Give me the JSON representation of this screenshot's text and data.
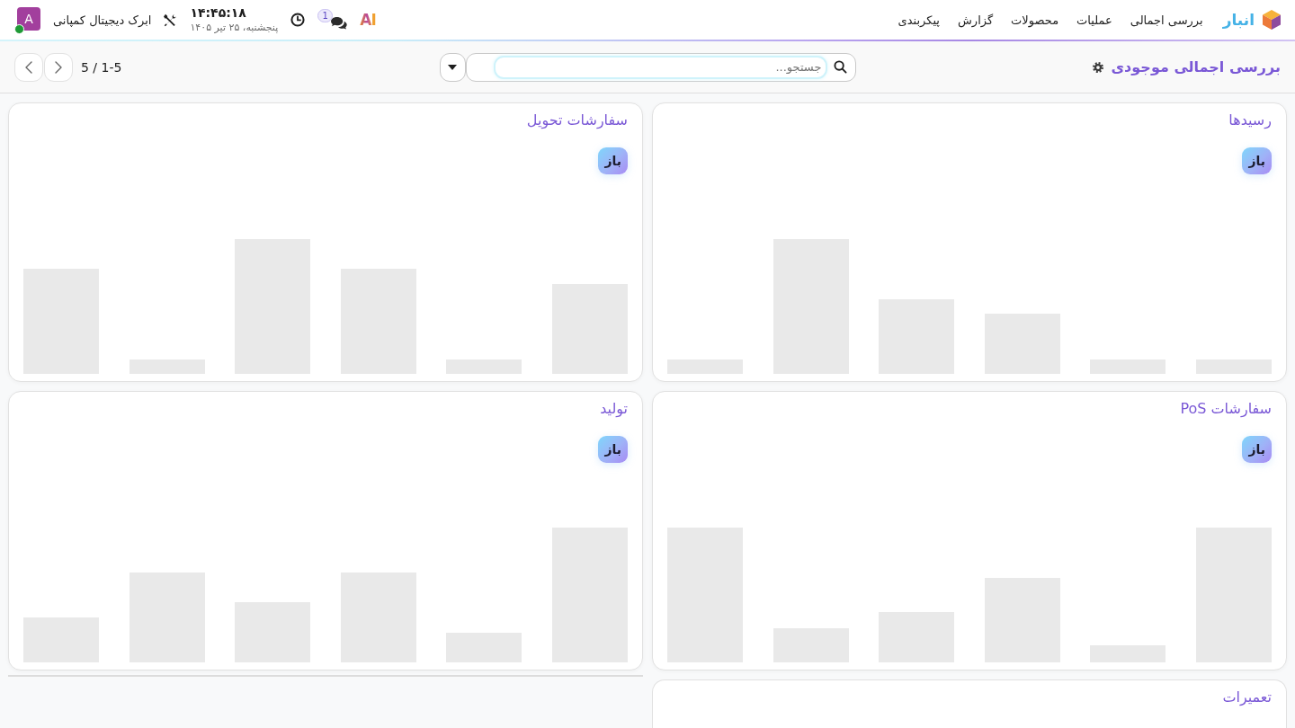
{
  "navbar": {
    "app_name": "انبار",
    "menu": [
      "بررسی اجمالی",
      "عملیات",
      "محصولات",
      "گزارش",
      "پیکربندی"
    ],
    "ai_button": {
      "label": "AI"
    },
    "messages": {
      "count": "1"
    },
    "clock": {
      "time": "۱۴:۴۵:۱۸",
      "date": "پنجشنبه، ۲۵ تیر ۱۴۰۵"
    },
    "company": "ابرک دیجیتال کمپانی",
    "user": {
      "initial": "A",
      "online": true
    }
  },
  "control_panel": {
    "title": "بررسی اجمالی موجودی",
    "search": {
      "placeholder": "جستجو..."
    },
    "pager": {
      "range": "5 / 1-5"
    }
  },
  "cards": [
    {
      "title": "رسیدها",
      "button": "باز"
    },
    {
      "title": "سفارشات تحویل",
      "button": "باز"
    },
    {
      "title": "سفارشات PoS",
      "button": "باز"
    },
    {
      "title": "تولید",
      "button": "باز"
    },
    {
      "title": "تعمیرات"
    }
  ]
}
